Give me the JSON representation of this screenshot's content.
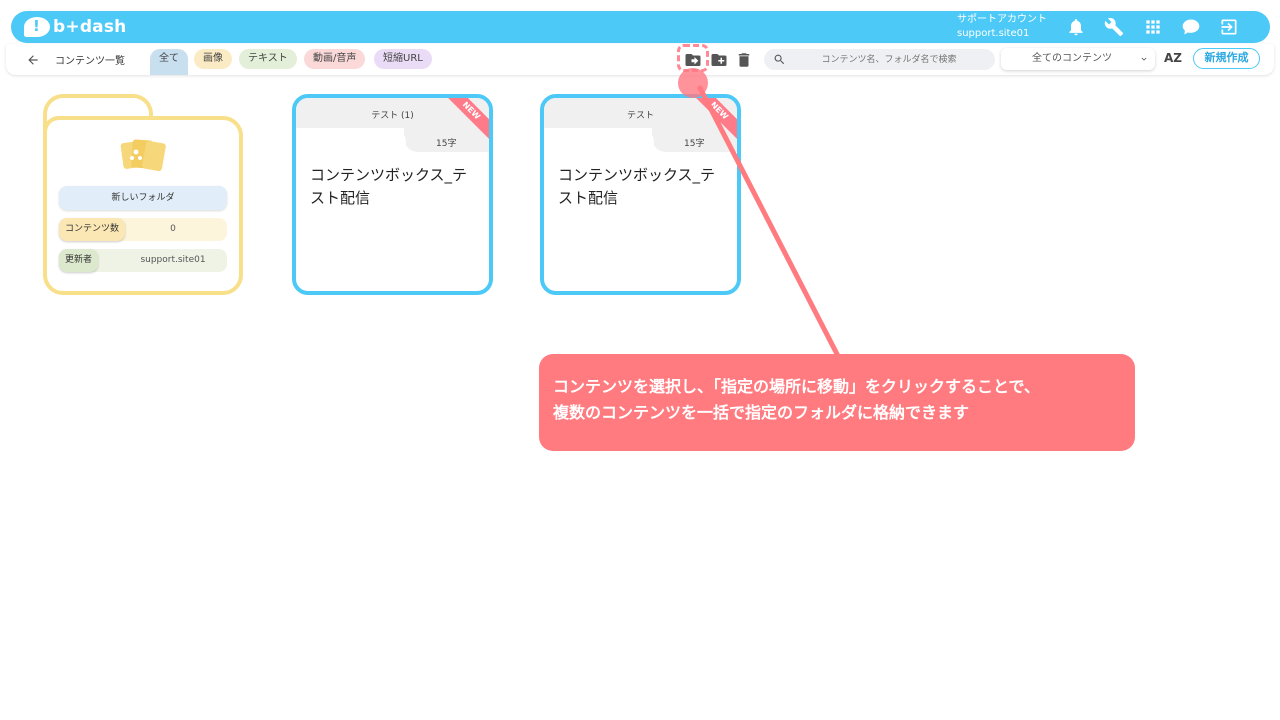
{
  "header": {
    "logo_text": "b+dash",
    "account_name": "サポートアカウント",
    "account_id": "support.site01"
  },
  "toolbar": {
    "page_title": "コンテンツ一覧",
    "filters": [
      {
        "label": "全て",
        "color": "#c8dff0",
        "active": true
      },
      {
        "label": "画像",
        "color": "#fbebc4"
      },
      {
        "label": "テキスト",
        "color": "#e3efd8"
      },
      {
        "label": "動画/音声",
        "color": "#fbd9d9"
      },
      {
        "label": "短縮URL",
        "color": "#eadcf6"
      }
    ],
    "search_placeholder": "コンテンツ名、フォルダ名で検索",
    "filter_select": "全てのコンテンツ",
    "sort_label": "AZ",
    "new_button": "新規作成"
  },
  "folder": {
    "name": "新しいフォルダ",
    "count_label": "コンテンツ数",
    "count_value": "0",
    "updater_label": "更新者",
    "updater_value": "support.site01",
    "accent": "#f8df8a"
  },
  "cards": [
    {
      "title": "テスト (1)",
      "count": "15字",
      "body": "コンテンツボックス_テスト配信",
      "badge": "NEW"
    },
    {
      "title": "テスト",
      "count": "15字",
      "body": "コンテンツボックス_テスト配信",
      "badge": "NEW"
    }
  ],
  "annotation": {
    "line1": "コンテンツを選択し、「指定の場所に移動」をクリックすることで、",
    "line2": "複数のコンテンツを一括で指定のフォルダに格納できます",
    "color": "#ff7b80"
  },
  "colors": {
    "brand": "#4cc9f7",
    "badge": "#ff7b8a"
  }
}
